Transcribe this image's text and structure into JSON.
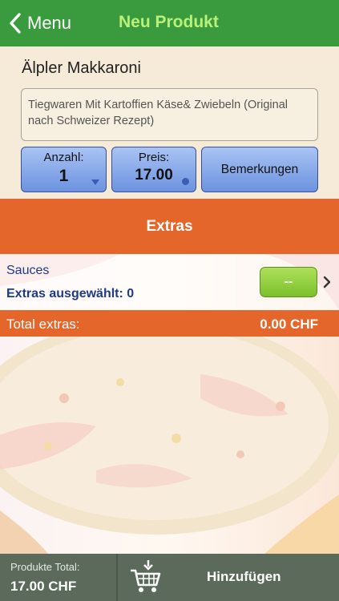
{
  "nav": {
    "back_label": "Menu",
    "title": "Neu Produkt"
  },
  "product": {
    "name": "Älpler Makkaroni",
    "description": "Tiegwaren Mit Kartoffien Käse& Zwiebeln (Original nach Schweizer Rezept)"
  },
  "buttons": {
    "quantity_caption": "Anzahl:",
    "quantity_value": "1",
    "price_caption": "Preis:",
    "price_value": "17.00",
    "remarks_label": "Bemerkungen"
  },
  "extras": {
    "banner": "Extras",
    "sauce_title": "Sauces",
    "selected_text": "Extras ausgewählt: 0",
    "selector_label": "--",
    "total_label": "Total extras:",
    "total_value": "0.00 CHF"
  },
  "footer": {
    "total_label": "Produkte Total:",
    "total_value": "17.00 CHF",
    "add_label": "Hinzufügen"
  },
  "colors": {
    "nav_green": "#3a9b3e",
    "title_green": "#b8f07a",
    "orange": "#e5662a",
    "button_blue": "#7aa0e6",
    "sauce_green": "#8fcd3b",
    "footer_gray": "#5b6a5b",
    "text_blue": "#1f3a86"
  },
  "icons": [
    "back-chevron-icon",
    "dropdown-arrow-icon",
    "dot-indicator-icon",
    "chevron-right-icon",
    "shopping-cart-icon"
  ]
}
